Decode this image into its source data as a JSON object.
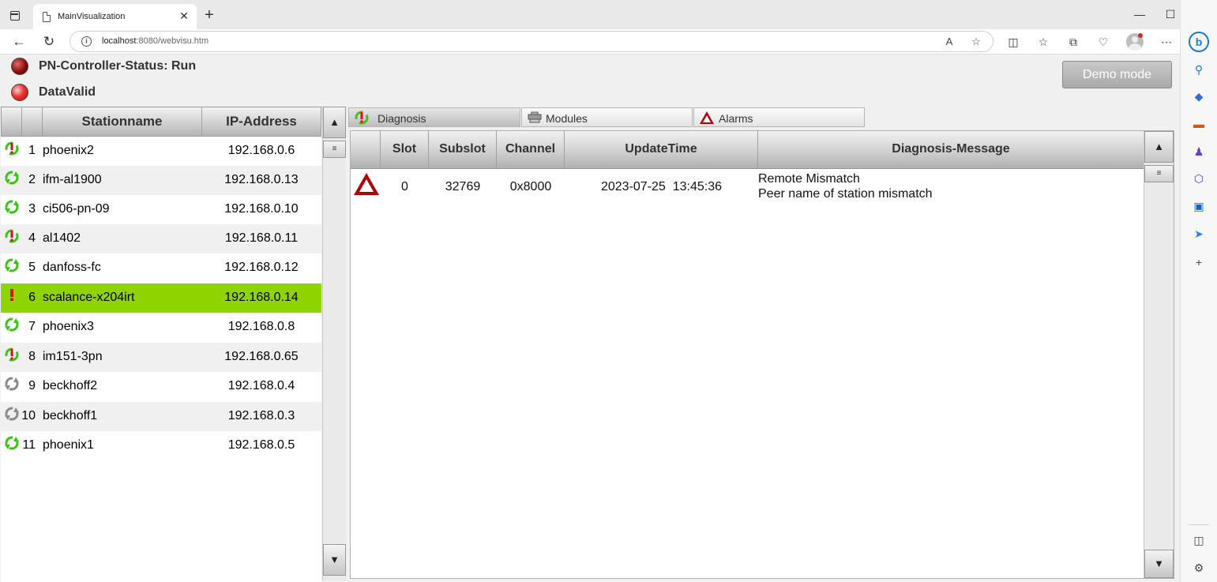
{
  "browser": {
    "tab_title": "MainVisualization",
    "url_host": "localhost",
    "url_rest": ":8080/webvisu.htm"
  },
  "visu": {
    "controller_status": "PN-Controller-Status: Run",
    "data_valid": "DataValid",
    "demo_button": "Demo mode",
    "station_table": {
      "headers": [
        "Stationname",
        "IP-Address"
      ],
      "rows": [
        {
          "num": "1",
          "name": "phoenix2",
          "ip": "192.168.0.6",
          "status": "error"
        },
        {
          "num": "2",
          "name": "ifm-al1900",
          "ip": "192.168.0.13",
          "status": "ok"
        },
        {
          "num": "3",
          "name": "ci506-pn-09",
          "ip": "192.168.0.10",
          "status": "ok"
        },
        {
          "num": "4",
          "name": "al1402",
          "ip": "192.168.0.11",
          "status": "error"
        },
        {
          "num": "5",
          "name": "danfoss-fc",
          "ip": "192.168.0.12",
          "status": "ok"
        },
        {
          "num": "6",
          "name": "scalance-x204irt",
          "ip": "192.168.0.14",
          "status": "warning"
        },
        {
          "num": "7",
          "name": "phoenix3",
          "ip": "192.168.0.8",
          "status": "ok"
        },
        {
          "num": "8",
          "name": "im151-3pn",
          "ip": "192.168.0.65",
          "status": "error"
        },
        {
          "num": "9",
          "name": "beckhoff2",
          "ip": "192.168.0.4",
          "status": "inactive"
        },
        {
          "num": "10",
          "name": "beckhoff1",
          "ip": "192.168.0.3",
          "status": "inactive"
        },
        {
          "num": "11",
          "name": "phoenix1",
          "ip": "192.168.0.5",
          "status": "ok"
        }
      ]
    },
    "tabs": {
      "diagnosis": "Diagnosis",
      "modules": "Modules",
      "alarms": "Alarms"
    },
    "diagnosis_table": {
      "headers": {
        "slot": "Slot",
        "subslot": "Subslot",
        "channel": "Channel",
        "update_time": "UpdateTime",
        "message": "Diagnosis-Message"
      },
      "rows": [
        {
          "slot": "0",
          "subslot": "32769",
          "channel": "0x8000",
          "update_time": "2023-07-25  13:45:36",
          "message_line1": "Remote Mismatch",
          "message_line2": "Peer name of station mismatch"
        }
      ]
    }
  },
  "colors": {
    "selected_row": "#8fd400",
    "status_ok": "#3ec21a",
    "status_error": "#d61010",
    "alarm": "#b00000"
  }
}
